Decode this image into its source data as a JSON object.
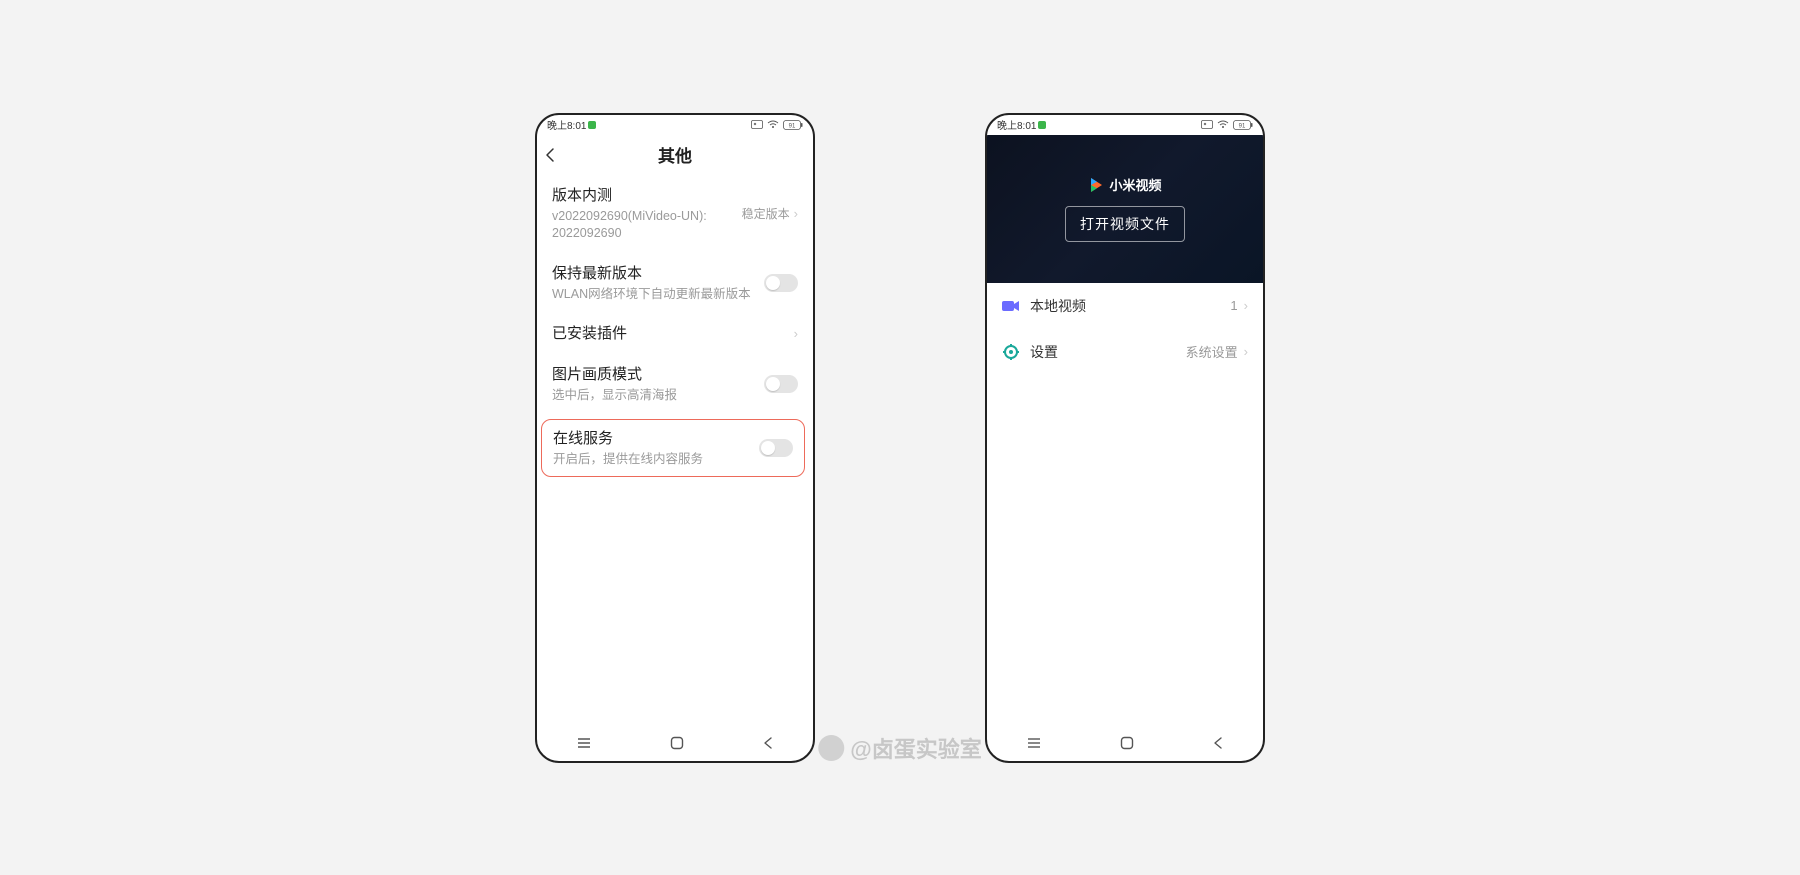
{
  "status": {
    "time": "晚上8:01",
    "battery": "91"
  },
  "phone1": {
    "title": "其他",
    "row_version": {
      "label": "版本内测",
      "sub": "v2022092690(MiVideo-UN): 2022092690",
      "tag": "稳定版本"
    },
    "row_update": {
      "label": "保持最新版本",
      "sub": "WLAN网络环境下自动更新最新版本"
    },
    "row_plugins": {
      "label": "已安装插件"
    },
    "row_quality": {
      "label": "图片画质模式",
      "sub": "选中后，显示高清海报"
    },
    "row_online": {
      "label": "在线服务",
      "sub": "开启后，提供在线内容服务"
    }
  },
  "phone2": {
    "brand": "小米视频",
    "open_button": "打开视频文件",
    "row_local": {
      "label": "本地视频",
      "count": "1"
    },
    "row_settings": {
      "label": "设置",
      "tag": "系统设置"
    }
  },
  "watermark": "@卤蛋实验室"
}
